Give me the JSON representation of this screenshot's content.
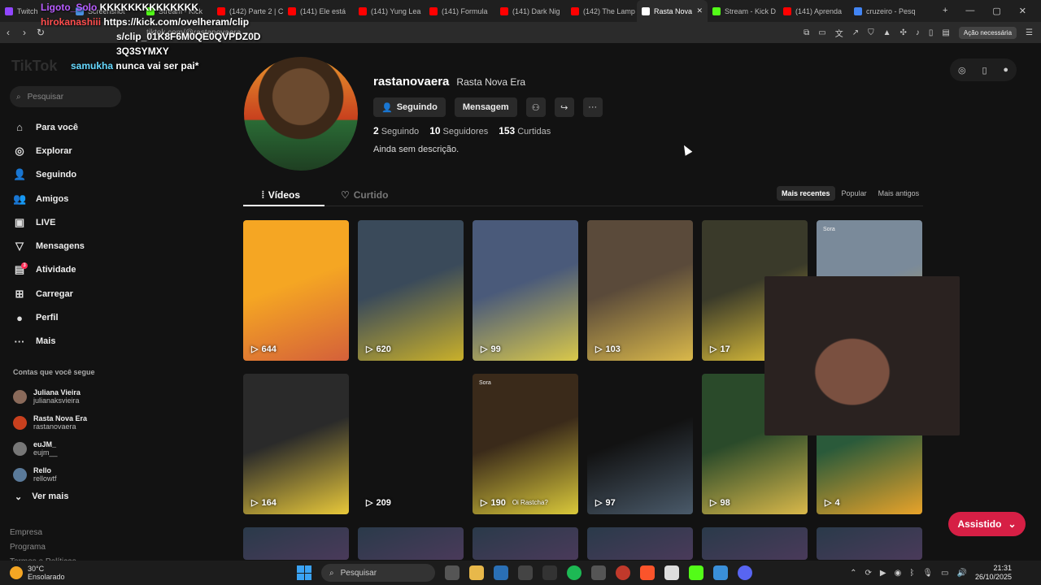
{
  "browser": {
    "tabs": [
      {
        "label": "Twitch",
        "color": "#9146ff"
      },
      {
        "label": "Screenshot",
        "color": "#4a90e2"
      },
      {
        "label": "Stream - Kick",
        "color": "#53fc18"
      },
      {
        "label": "(142) Parte 2 | C",
        "color": "#ff0000"
      },
      {
        "label": "(141) Ele está",
        "color": "#ff0000"
      },
      {
        "label": "(141) Yung Lea",
        "color": "#ff0000"
      },
      {
        "label": "(141) Formula",
        "color": "#ff0000"
      },
      {
        "label": "(141) Dark Nig",
        "color": "#ff0000"
      },
      {
        "label": "(142) The Lamp",
        "color": "#ff0000"
      },
      {
        "label": "Rasta Nova",
        "color": "#ffffff",
        "active": true
      },
      {
        "label": "Stream - Kick D",
        "color": "#53fc18"
      },
      {
        "label": "(141) Aprenda",
        "color": "#ff0000"
      },
      {
        "label": "cruzeiro - Pesq",
        "color": "#4285f4"
      }
    ],
    "url": "tiktok.com/@rastanovaera",
    "acao_label": "Ação necessária"
  },
  "overlay": {
    "line1_user": "Ligoto_Solo",
    "line1_msg": "KKKKKKKKKKKKKK",
    "line2_user": "hirokanashiii",
    "line2_msg": "https://kick.com/ovelheram/clip",
    "line3_msg": "s/clip_01K8F6M0QE0QVPDZ0D",
    "line4_msg": "3Q3SYMXY",
    "line5_user": "samukha",
    "line5_msg": "nunca vai ser pai*"
  },
  "sidebar": {
    "logo": "TikTok",
    "search_placeholder": "Pesquisar",
    "items": [
      {
        "label": "Para você",
        "icon": "home-icon",
        "glyph": "⌂"
      },
      {
        "label": "Explorar",
        "icon": "compass-icon",
        "glyph": "◎"
      },
      {
        "label": "Seguindo",
        "icon": "following-icon",
        "glyph": "👤"
      },
      {
        "label": "Amigos",
        "icon": "friends-icon",
        "glyph": "👥"
      },
      {
        "label": "LIVE",
        "icon": "live-icon",
        "glyph": "▣"
      },
      {
        "label": "Mensagens",
        "icon": "messages-icon",
        "glyph": "▽"
      },
      {
        "label": "Atividade",
        "icon": "activity-icon",
        "glyph": "▤",
        "badge": "3"
      },
      {
        "label": "Carregar",
        "icon": "upload-icon",
        "glyph": "⊞"
      },
      {
        "label": "Perfil",
        "icon": "profile-icon",
        "glyph": "●"
      },
      {
        "label": "Mais",
        "icon": "more-icon",
        "glyph": "···"
      }
    ],
    "following_title": "Contas que você segue",
    "following": [
      {
        "name": "Juliana Vieira",
        "user": "julianaksvieira",
        "color": "#8a6a5a"
      },
      {
        "name": "Rasta Nova Era",
        "user": "rastanovaera",
        "color": "#c8401e"
      },
      {
        "name": "euJM_",
        "user": "eujm__",
        "color": "#777"
      },
      {
        "name": "Rello",
        "user": "rellowtf",
        "color": "#5a7a9a"
      }
    ],
    "ver_mais": "Ver mais",
    "footer": [
      "Empresa",
      "Programa",
      "Termos e Políticas"
    ]
  },
  "profile": {
    "username": "rastanovaera",
    "display_name": "Rasta Nova Era",
    "follow_button": "Seguindo",
    "message_button": "Mensagem",
    "following_count": "2",
    "following_label": "Seguindo",
    "followers_count": "10",
    "followers_label": "Seguidores",
    "likes_count": "153",
    "likes_label": "Curtidas",
    "bio": "Ainda sem descrição.",
    "tab_videos": "Vídeos",
    "tab_liked": "Curtido",
    "sort": [
      "Mais recentes",
      "Popular",
      "Mais antigos"
    ]
  },
  "videos": [
    {
      "views": "644",
      "c1": "#f5a623",
      "c2": "#d4603a"
    },
    {
      "views": "620",
      "c1": "#3a4a5a",
      "c2": "#c9b02a"
    },
    {
      "views": "99",
      "c1": "#4a5a7a",
      "c2": "#d9c84a"
    },
    {
      "views": "103",
      "c1": "#5a4a3a",
      "c2": "#d9b84a"
    },
    {
      "views": "17",
      "c1": "#3a3a2a",
      "c2": "#e8c83a"
    },
    {
      "views": "",
      "c1": "#7a8a9a",
      "c2": "#c8a83a",
      "sora": "Sora"
    },
    {
      "views": "164",
      "c1": "#2a2a2a",
      "c2": "#e8c83a"
    },
    {
      "views": "209",
      "c1": "#121212",
      "c2": "#121212"
    },
    {
      "views": "190",
      "c1": "#3a2a1a",
      "c2": "#d9c83a",
      "caption": "Oi Rastcha?",
      "sora": "Sora"
    },
    {
      "views": "97",
      "c1": "#121212",
      "c2": "#4a5a6a"
    },
    {
      "views": "98",
      "c1": "#2a4a2a",
      "c2": "#d9b84a"
    },
    {
      "views": "4",
      "c1": "#2a5a3a",
      "c2": "#e8a32a"
    }
  ],
  "assistido_label": "Assistido",
  "taskbar": {
    "temp": "30°C",
    "weather": "Ensolarado",
    "search_placeholder": "Pesquisar",
    "time": "21:31",
    "date": "26/10/2025"
  }
}
